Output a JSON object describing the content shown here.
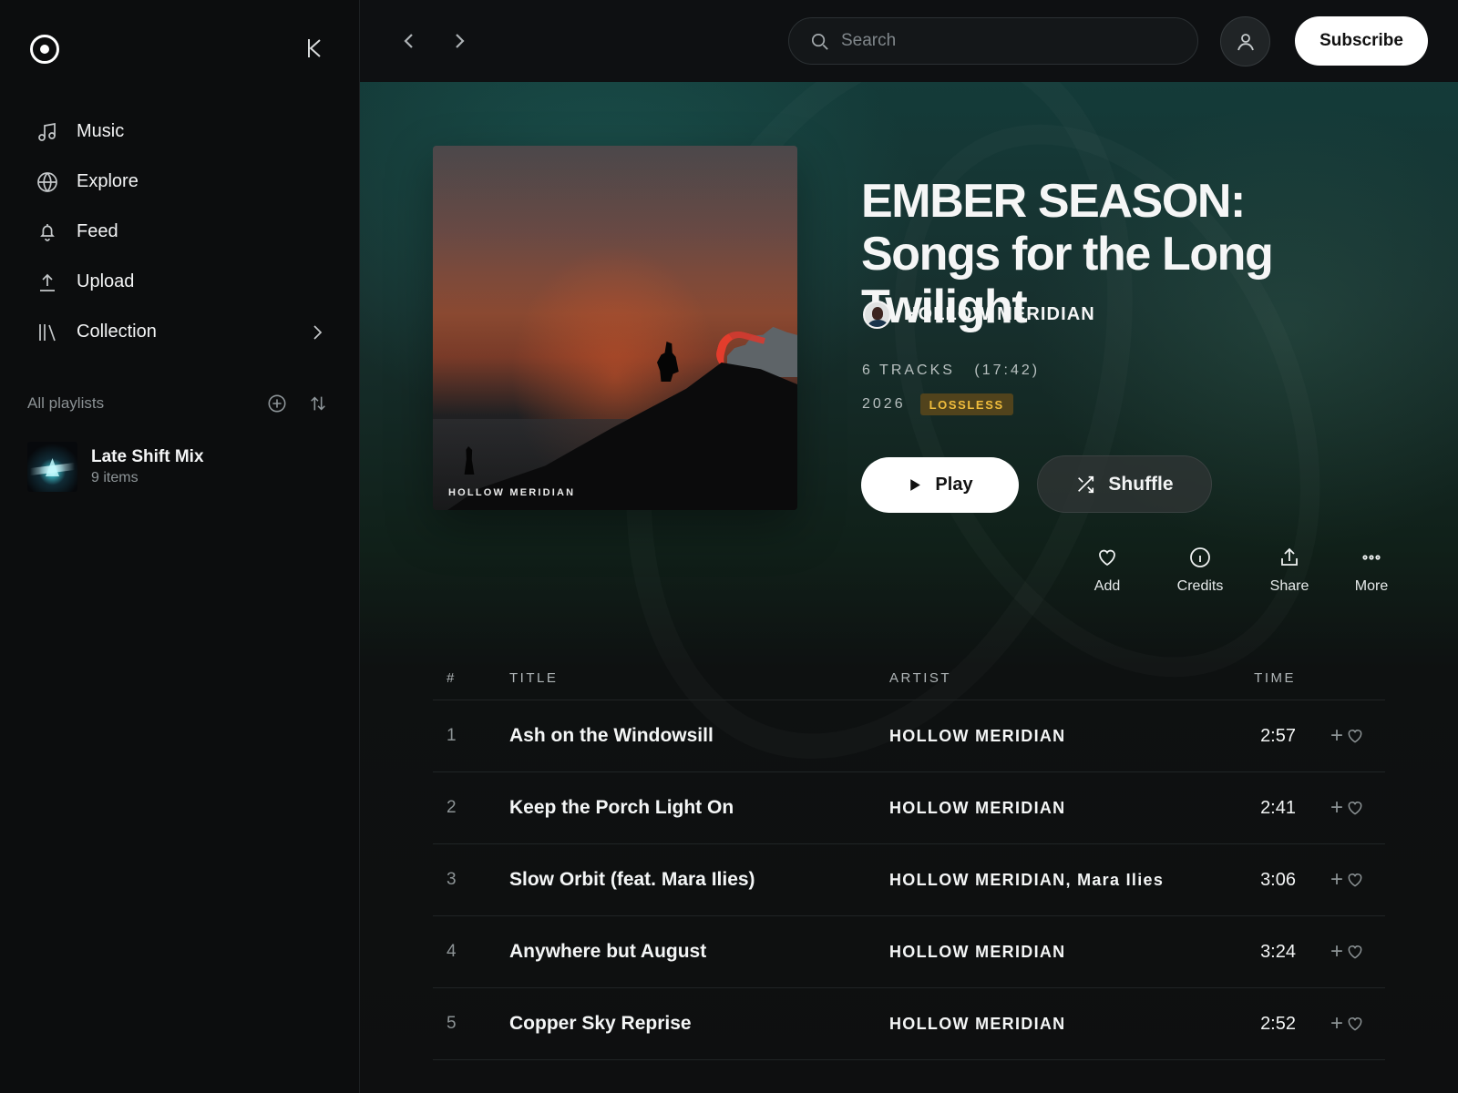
{
  "sidebar": {
    "nav": [
      {
        "label": "Music",
        "icon": "music-note-icon"
      },
      {
        "label": "Explore",
        "icon": "globe-icon"
      },
      {
        "label": "Feed",
        "icon": "bell-icon"
      },
      {
        "label": "Upload",
        "icon": "upload-icon"
      },
      {
        "label": "Collection",
        "icon": "library-icon"
      }
    ],
    "playlists_title": "All playlists",
    "playlist": {
      "name": "Late Shift Mix",
      "count": "9 items"
    }
  },
  "topbar": {
    "search_placeholder": "Search",
    "subscribe": "Subscribe"
  },
  "album": {
    "cover_artist": "HOLLOW MERIDIAN",
    "title": "EMBER SEASON: Songs for the Long Twilight",
    "artist": "HOLLOW MERIDIAN",
    "tracks": "6 TRACKS",
    "duration": "(17:42)",
    "year": "2026",
    "badge": "LOSSLESS",
    "play": "Play",
    "shuffle": "Shuffle",
    "actions": [
      "Add",
      "Credits",
      "Share",
      "More"
    ],
    "colors": {
      "badge_text": "#f1bd3c",
      "accent_teal": "#143b39"
    }
  },
  "track_table": {
    "headers": [
      "#",
      "TITLE",
      "ARTIST",
      "TIME"
    ],
    "rows": [
      {
        "num": "1",
        "title": "Ash on the Windowsill",
        "artist": "HOLLOW MERIDIAN",
        "time": "2:57"
      },
      {
        "num": "2",
        "title": "Keep the Porch Light On",
        "artist": "HOLLOW MERIDIAN",
        "time": "2:41"
      },
      {
        "num": "3",
        "title": "Slow Orbit (feat. Mara Ilies)",
        "artist": "HOLLOW MERIDIAN, Mara Ilies",
        "time": "3:06"
      },
      {
        "num": "4",
        "title": "Anywhere but August",
        "artist": "HOLLOW MERIDIAN",
        "time": "3:24"
      },
      {
        "num": "5",
        "title": "Copper Sky Reprise",
        "artist": "HOLLOW MERIDIAN",
        "time": "2:52"
      }
    ]
  }
}
